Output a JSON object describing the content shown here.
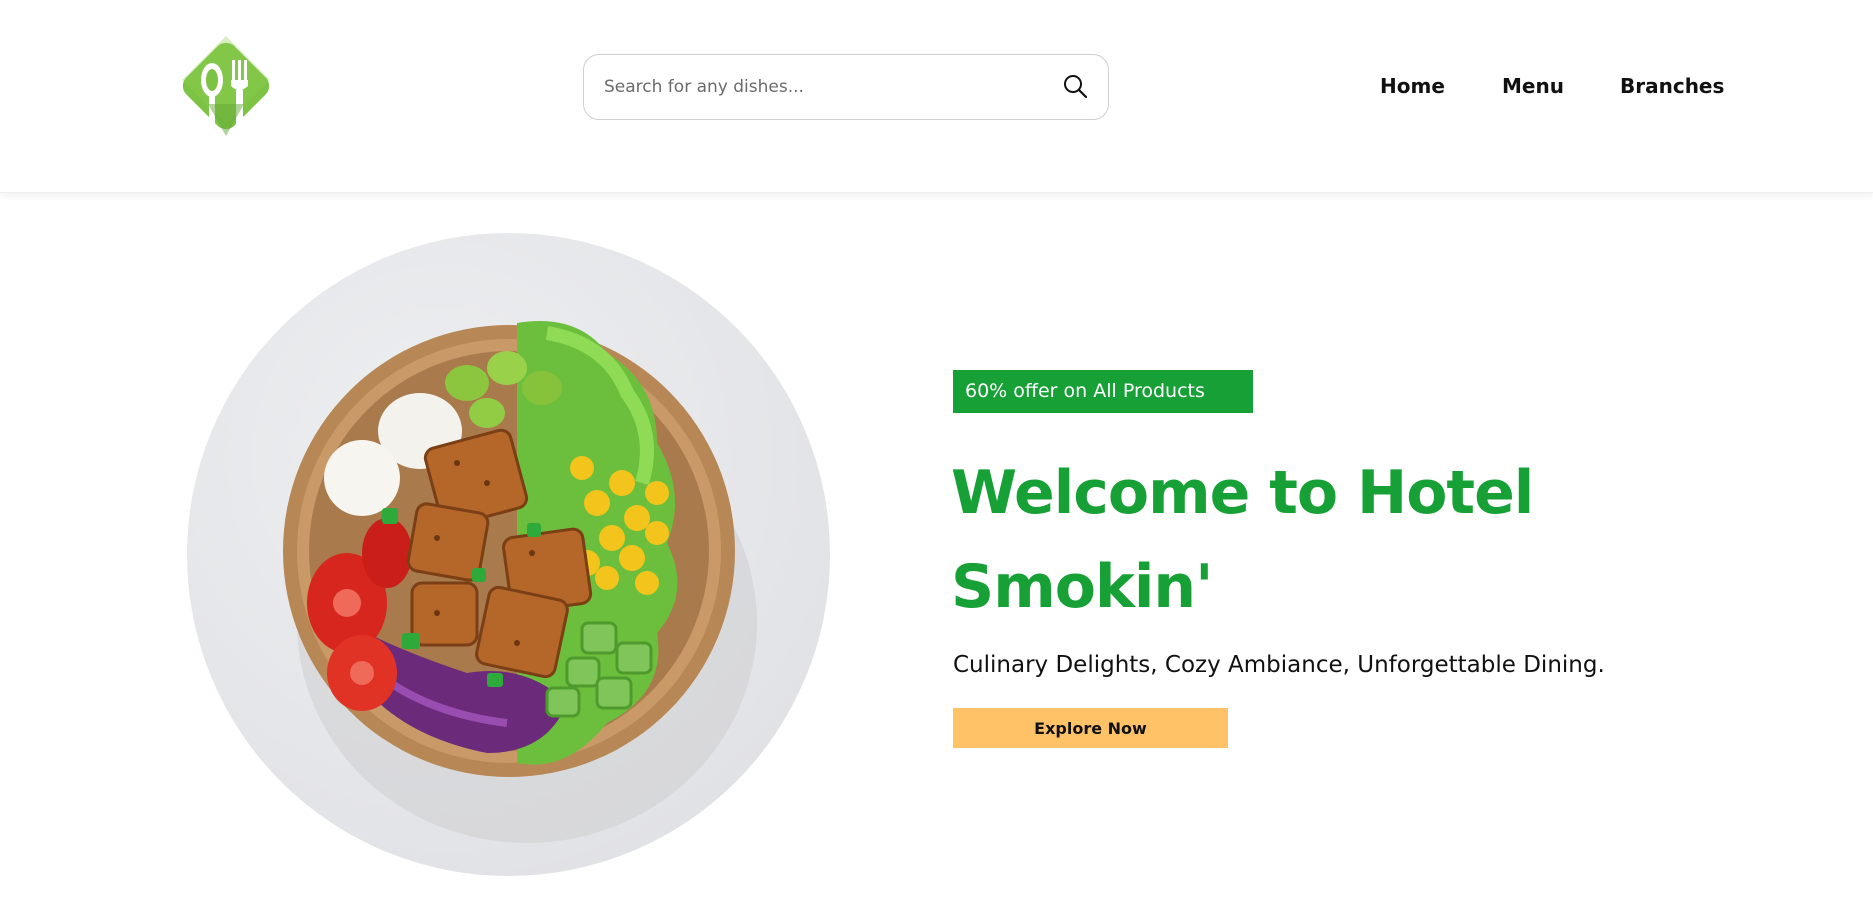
{
  "brand": {
    "logo_icon": "spoon-fork-icon",
    "logo_color": "#7cc243"
  },
  "search": {
    "placeholder": "Search for any dishes...",
    "value": "",
    "icon": "search-icon"
  },
  "nav": {
    "items": [
      "Home",
      "Menu",
      "Branches"
    ]
  },
  "hero": {
    "offer": "60% offer on All Products",
    "title": "Welcome to Hotel Smokin'",
    "subtitle": "Culinary Delights, Cozy Ambiance, Unforgettable Dining.",
    "cta": "Explore Now",
    "image": "salad-bowl-image"
  },
  "colors": {
    "accent_green": "#16a035",
    "cta_orange": "#ffc266"
  }
}
